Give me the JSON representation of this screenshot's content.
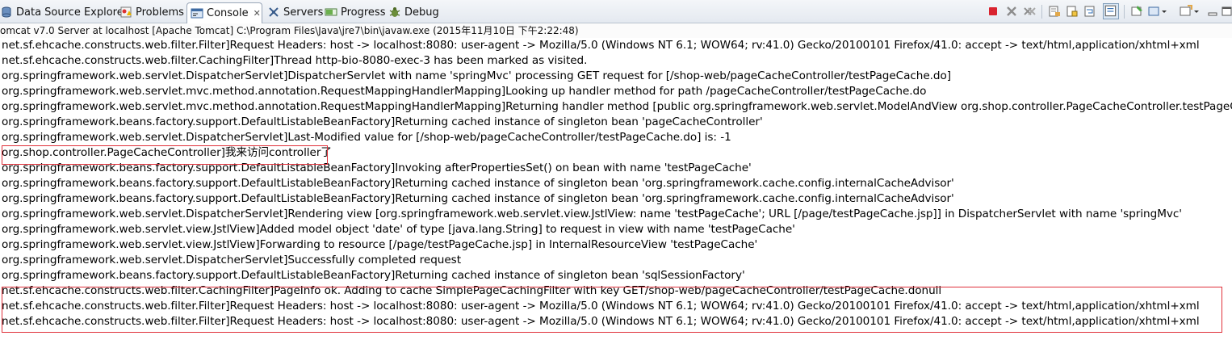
{
  "tabs": [
    {
      "label": "Data Source Explorer",
      "icon": "data-source-icon"
    },
    {
      "label": "Problems",
      "icon": "problems-icon"
    },
    {
      "label": "Console",
      "icon": "console-icon",
      "close": "✕"
    },
    {
      "label": "Servers",
      "icon": "servers-icon"
    },
    {
      "label": "Progress",
      "icon": "progress-icon"
    },
    {
      "label": "Debug",
      "icon": "debug-icon"
    }
  ],
  "colors": {
    "terminate": "#d9232f",
    "accent": "#2c6cb4",
    "highlight_box": "#e0303a"
  },
  "console_title": "omcat v7.0 Server at localhost [Apache Tomcat] C:\\Program Files\\Java\\jre7\\bin\\javaw.exe (2015年11月10日 下午2:22:48)",
  "lines": [
    "net.sf.ehcache.constructs.web.filter.Filter]Request Headers: host -> localhost:8080: user-agent -> Mozilla/5.0 (Windows NT 6.1; WOW64; rv:41.0) Gecko/20100101 Firefox/41.0: accept -> text/html,application/xhtml+xml",
    "net.sf.ehcache.constructs.web.filter.CachingFilter]Thread http-bio-8080-exec-3  has been marked as visited.",
    "org.springframework.web.servlet.DispatcherServlet]DispatcherServlet with name 'springMvc' processing GET request for [/shop-web/pageCacheController/testPageCache.do]",
    "org.springframework.web.servlet.mvc.method.annotation.RequestMappingHandlerMapping]Looking up handler method for path /pageCacheController/testPageCache.do",
    "org.springframework.web.servlet.mvc.method.annotation.RequestMappingHandlerMapping]Returning handler method [public org.springframework.web.servlet.ModelAndView org.shop.controller.PageCacheController.testPageCache()]",
    "org.springframework.beans.factory.support.DefaultListableBeanFactory]Returning cached instance of singleton bean 'pageCacheController'",
    "org.springframework.web.servlet.DispatcherServlet]Last-Modified value for [/shop-web/pageCacheController/testPageCache.do] is: -1",
    "org.shop.controller.PageCacheController]我来访问controller了",
    "org.springframework.beans.factory.support.DefaultListableBeanFactory]Invoking afterPropertiesSet() on bean with name 'testPageCache'",
    "org.springframework.beans.factory.support.DefaultListableBeanFactory]Returning cached instance of singleton bean 'org.springframework.cache.config.internalCacheAdvisor'",
    "org.springframework.beans.factory.support.DefaultListableBeanFactory]Returning cached instance of singleton bean 'org.springframework.cache.config.internalCacheAdvisor'",
    "org.springframework.web.servlet.DispatcherServlet]Rendering view [org.springframework.web.servlet.view.JstlView: name 'testPageCache'; URL [/page/testPageCache.jsp]] in DispatcherServlet with name 'springMvc'",
    "org.springframework.web.servlet.view.JstlView]Added model object 'date' of type [java.lang.String] to request in view with name 'testPageCache'",
    "org.springframework.web.servlet.view.JstlView]Forwarding to resource [/page/testPageCache.jsp] in InternalResourceView 'testPageCache'",
    "org.springframework.web.servlet.DispatcherServlet]Successfully completed request",
    "org.springframework.beans.factory.support.DefaultListableBeanFactory]Returning cached instance of singleton bean 'sqlSessionFactory'",
    "net.sf.ehcache.constructs.web.filter.CachingFilter]PageInfo ok. Adding to cache SimplePageCachingFilter with key GET/shop-web/pageCacheController/testPageCache.donull",
    "net.sf.ehcache.constructs.web.filter.Filter]Request Headers: host -> localhost:8080: user-agent -> Mozilla/5.0 (Windows NT 6.1; WOW64; rv:41.0) Gecko/20100101 Firefox/41.0: accept -> text/html,application/xhtml+xml",
    "net.sf.ehcache.constructs.web.filter.Filter]Request Headers: host -> localhost:8080: user-agent -> Mozilla/5.0 (Windows NT 6.1; WOW64; rv:41.0) Gecko/20100101 Firefox/41.0: accept -> text/html,application/xhtml+xml"
  ]
}
